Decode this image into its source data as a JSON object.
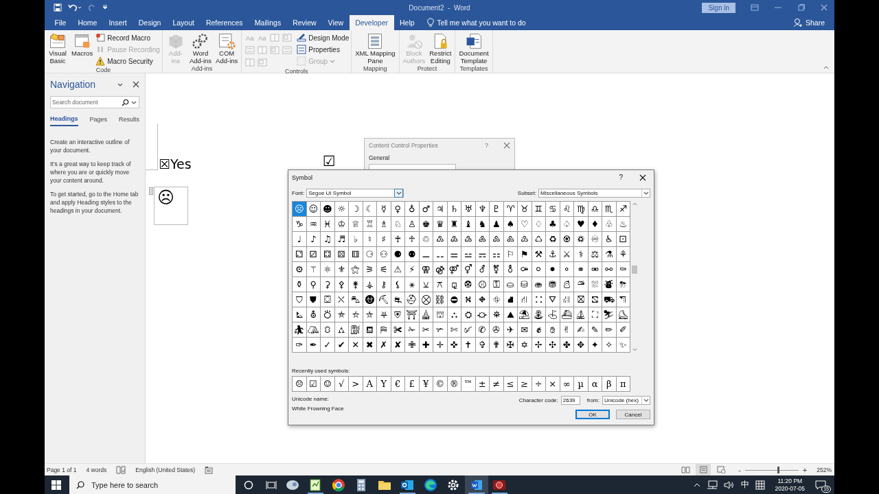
{
  "title_bar": {
    "title": "Document2  -  Word",
    "sign_in": "Sign in"
  },
  "tabs": [
    {
      "label": "File",
      "selected": false
    },
    {
      "label": "Home",
      "selected": false
    },
    {
      "label": "Insert",
      "selected": false
    },
    {
      "label": "Design",
      "selected": false
    },
    {
      "label": "Layout",
      "selected": false
    },
    {
      "label": "References",
      "selected": false
    },
    {
      "label": "Mailings",
      "selected": false
    },
    {
      "label": "Review",
      "selected": false
    },
    {
      "label": "View",
      "selected": false
    },
    {
      "label": "Developer",
      "selected": true
    },
    {
      "label": "Help",
      "selected": false
    }
  ],
  "tell_me": "Tell me what you want to do",
  "share": "Share",
  "ribbon": {
    "groups": [
      {
        "label": "Code",
        "items": [
          {
            "kind": "large",
            "label": "Visual\nBasic",
            "disabled": false
          },
          {
            "kind": "large",
            "label": "Macros",
            "disabled": false
          },
          {
            "kind": "small",
            "label": "Record Macro",
            "disabled": false
          },
          {
            "kind": "small",
            "label": "Pause Recording",
            "disabled": true
          },
          {
            "kind": "small",
            "label": "Macro Security",
            "disabled": false
          }
        ]
      },
      {
        "label": "Add-ins",
        "items": [
          {
            "kind": "large",
            "label": "Add-\nins",
            "disabled": true
          },
          {
            "kind": "large",
            "label": "Word\nAdd-ins",
            "disabled": false
          },
          {
            "kind": "large",
            "label": "COM\nAdd-ins",
            "disabled": false
          }
        ]
      },
      {
        "label": "Controls",
        "items": [
          {
            "kind": "tool",
            "text": "Aa",
            "disabled": true
          },
          {
            "kind": "tool",
            "text": "Aa",
            "disabled": true
          },
          {
            "kind": "tool",
            "disabled": true
          },
          {
            "kind": "tool",
            "disabled": true
          },
          {
            "kind": "tool",
            "disabled": true
          },
          {
            "kind": "tool",
            "disabled": true
          },
          {
            "kind": "tool",
            "disabled": true
          },
          {
            "kind": "tool",
            "disabled": true
          },
          {
            "kind": "tool",
            "disabled": true
          },
          {
            "kind": "tool",
            "disabled": true
          },
          {
            "kind": "small",
            "label": "Design Mode",
            "disabled": false
          },
          {
            "kind": "small",
            "label": "Properties",
            "disabled": false
          },
          {
            "kind": "small",
            "label": "Group",
            "disabled": true
          }
        ]
      },
      {
        "label": "Mapping",
        "items": [
          {
            "kind": "large",
            "label": "XML Mapping\nPane",
            "disabled": false
          }
        ]
      },
      {
        "label": "Protect",
        "items": [
          {
            "kind": "large",
            "label": "Block\nAuthors",
            "disabled": true
          },
          {
            "kind": "large",
            "label": "Restrict\nEditing",
            "disabled": false
          }
        ]
      },
      {
        "label": "Templates",
        "items": [
          {
            "kind": "large",
            "label": "Document\nTemplate",
            "disabled": false
          }
        ]
      }
    ]
  },
  "navigation": {
    "title": "Navigation",
    "search_placeholder": "Search document",
    "tabs": [
      {
        "label": "Headings",
        "selected": true
      },
      {
        "label": "Pages",
        "selected": false
      },
      {
        "label": "Results",
        "selected": false
      }
    ],
    "paragraphs": [
      "Create an interactive outline of your document.",
      "It’s a great way to keep track of where you are or quickly move your content around.",
      "To get started, go to the Home tab and apply Heading styles to the headings in your document."
    ]
  },
  "document": {
    "yes_line": "☒Yes",
    "check": "☑",
    "control_symbol": "☹"
  },
  "content_control_dialog": {
    "title": "Content Control Properties",
    "help": "?",
    "section": "General"
  },
  "symbol_dialog": {
    "title": "Symbol",
    "help": "?",
    "font_label": "Font:",
    "font": "Segoe UI Symbol",
    "subset_label": "Subset:",
    "subset": "Miscellaneous Symbols",
    "grid": [
      [
        {
          "char": "☹",
          "selected": true
        },
        {
          "char": "☺",
          "selected": false
        },
        {
          "char": "☻",
          "selected": false
        },
        {
          "char": "☼",
          "selected": false
        },
        {
          "char": "☽",
          "selected": false
        },
        {
          "char": "☾",
          "selected": false
        },
        {
          "char": "☿",
          "selected": false
        },
        {
          "char": "♀",
          "selected": false
        },
        {
          "char": "♁",
          "selected": false
        },
        {
          "char": "♂",
          "selected": false
        },
        {
          "char": "♃",
          "selected": false
        },
        {
          "char": "♄",
          "selected": false
        },
        {
          "char": "♅",
          "selected": false
        },
        {
          "char": "♆",
          "selected": false
        },
        {
          "char": "♇",
          "selected": false
        },
        {
          "char": "♈",
          "selected": false
        },
        {
          "char": "♉",
          "selected": false
        },
        {
          "char": "♊",
          "selected": false
        },
        {
          "char": "♋",
          "selected": false
        },
        {
          "char": "♌",
          "selected": false
        },
        {
          "char": "♍",
          "selected": false
        },
        {
          "char": "♎",
          "selected": false
        },
        {
          "char": "♏",
          "selected": false
        },
        {
          "char": "♐",
          "selected": false
        }
      ],
      [
        {
          "char": "♑",
          "selected": false
        },
        {
          "char": "♒",
          "selected": false
        },
        {
          "char": "♓",
          "selected": false
        },
        {
          "char": "♔",
          "selected": false
        },
        {
          "char": "♕",
          "selected": false
        },
        {
          "char": "♖",
          "selected": false
        },
        {
          "char": "♗",
          "selected": false
        },
        {
          "char": "♘",
          "selected": false
        },
        {
          "char": "♙",
          "selected": false
        },
        {
          "char": "♚",
          "selected": false
        },
        {
          "char": "♛",
          "selected": false
        },
        {
          "char": "♜",
          "selected": false
        },
        {
          "char": "♝",
          "selected": false
        },
        {
          "char": "♞",
          "selected": false
        },
        {
          "char": "♟",
          "selected": false
        },
        {
          "char": "♠",
          "selected": false
        },
        {
          "char": "♡",
          "selected": false
        },
        {
          "char": "♢",
          "selected": false
        },
        {
          "char": "♣",
          "selected": false
        },
        {
          "char": "♤",
          "selected": false
        },
        {
          "char": "♥",
          "selected": false
        },
        {
          "char": "♦",
          "selected": false
        },
        {
          "char": "♧",
          "selected": false
        },
        {
          "char": "♨",
          "selected": false
        }
      ],
      [
        {
          "char": "♩",
          "selected": false
        },
        {
          "char": "♪",
          "selected": false
        },
        {
          "char": "♫",
          "selected": false
        },
        {
          "char": "♬",
          "selected": false
        },
        {
          "char": "♭",
          "selected": false
        },
        {
          "char": "♮",
          "selected": false
        },
        {
          "char": "♯",
          "selected": false
        },
        {
          "char": "♰",
          "selected": false
        },
        {
          "char": "♱",
          "selected": false
        },
        {
          "char": "♲",
          "selected": false
        },
        {
          "char": "♳",
          "selected": false
        },
        {
          "char": "♴",
          "selected": false
        },
        {
          "char": "♵",
          "selected": false
        },
        {
          "char": "♶",
          "selected": false
        },
        {
          "char": "♷",
          "selected": false
        },
        {
          "char": "♸",
          "selected": false
        },
        {
          "char": "♹",
          "selected": false
        },
        {
          "char": "♺",
          "selected": false
        },
        {
          "char": "♻",
          "selected": false
        },
        {
          "char": "♼",
          "selected": false
        },
        {
          "char": "♽",
          "selected": false
        },
        {
          "char": "♾",
          "selected": false
        },
        {
          "char": "♿",
          "selected": false
        },
        {
          "char": "⚀",
          "selected": false
        }
      ],
      [
        {
          "char": "⚁",
          "selected": false
        },
        {
          "char": "⚂",
          "selected": false
        },
        {
          "char": "⚃",
          "selected": false
        },
        {
          "char": "⚄",
          "selected": false
        },
        {
          "char": "⚅",
          "selected": false
        },
        {
          "char": "⚆",
          "selected": false
        },
        {
          "char": "⚇",
          "selected": false
        },
        {
          "char": "⚈",
          "selected": false
        },
        {
          "char": "⚉",
          "selected": false
        },
        {
          "char": "⚊",
          "selected": false
        },
        {
          "char": "⚋",
          "selected": false
        },
        {
          "char": "⚌",
          "selected": false
        },
        {
          "char": "⚍",
          "selected": false
        },
        {
          "char": "⚎",
          "selected": false
        },
        {
          "char": "⚏",
          "selected": false
        },
        {
          "char": "⚐",
          "selected": false
        },
        {
          "char": "⚑",
          "selected": false
        },
        {
          "char": "⚒",
          "selected": false
        },
        {
          "char": "⚓",
          "selected": false
        },
        {
          "char": "⚔",
          "selected": false
        },
        {
          "char": "⚕",
          "selected": false
        },
        {
          "char": "⚖",
          "selected": false
        },
        {
          "char": "⚗",
          "selected": false
        },
        {
          "char": "⚘",
          "selected": false
        }
      ],
      [
        {
          "char": "⚙",
          "selected": false
        },
        {
          "char": "⚚",
          "selected": false
        },
        {
          "char": "⚛",
          "selected": false
        },
        {
          "char": "⚜",
          "selected": false
        },
        {
          "char": "⚝",
          "selected": false
        },
        {
          "char": "⚞",
          "selected": false
        },
        {
          "char": "⚟",
          "selected": false
        },
        {
          "char": "⚠",
          "selected": false
        },
        {
          "char": "⚡",
          "selected": false
        },
        {
          "char": "⚢",
          "selected": false
        },
        {
          "char": "⚣",
          "selected": false
        },
        {
          "char": "⚤",
          "selected": false
        },
        {
          "char": "⚥",
          "selected": false
        },
        {
          "char": "⚦",
          "selected": false
        },
        {
          "char": "⚧",
          "selected": false
        },
        {
          "char": "⚨",
          "selected": false
        },
        {
          "char": "⚩",
          "selected": false
        },
        {
          "char": "⚪",
          "selected": false
        },
        {
          "char": "⚫",
          "selected": false
        },
        {
          "char": "⚬",
          "selected": false
        },
        {
          "char": "⚭",
          "selected": false
        },
        {
          "char": "⚮",
          "selected": false
        },
        {
          "char": "⚯",
          "selected": false
        },
        {
          "char": "⚰",
          "selected": false
        }
      ],
      [
        {
          "char": "⚱",
          "selected": false
        },
        {
          "char": "⚲",
          "selected": false
        },
        {
          "char": "⚳",
          "selected": false
        },
        {
          "char": "⚴",
          "selected": false
        },
        {
          "char": "⚵",
          "selected": false
        },
        {
          "char": "⚶",
          "selected": false
        },
        {
          "char": "⚷",
          "selected": false
        },
        {
          "char": "⚸",
          "selected": false
        },
        {
          "char": "⚹",
          "selected": false
        },
        {
          "char": "⚺",
          "selected": false
        },
        {
          "char": "⚻",
          "selected": false
        },
        {
          "char": "⚼",
          "selected": false
        },
        {
          "char": "⚽",
          "selected": false
        },
        {
          "char": "⚾",
          "selected": false
        },
        {
          "char": "⚿",
          "selected": false
        },
        {
          "char": "⛀",
          "selected": false
        },
        {
          "char": "⛁",
          "selected": false
        },
        {
          "char": "⛂",
          "selected": false
        },
        {
          "char": "⛃",
          "selected": false
        },
        {
          "char": "⛄",
          "selected": false
        },
        {
          "char": "⛅",
          "selected": false
        },
        {
          "char": "⛆",
          "selected": false
        },
        {
          "char": "⛇",
          "selected": false
        },
        {
          "char": "⛈",
          "selected": false
        }
      ],
      [
        {
          "char": "⛉",
          "selected": false
        },
        {
          "char": "⛊",
          "selected": false
        },
        {
          "char": "⛋",
          "selected": false
        },
        {
          "char": "⛌",
          "selected": false
        },
        {
          "char": "⛍",
          "selected": false
        },
        {
          "char": "⛎",
          "selected": false
        },
        {
          "char": "⛏",
          "selected": false
        },
        {
          "char": "⛐",
          "selected": false
        },
        {
          "char": "⛑",
          "selected": false
        },
        {
          "char": "⛒",
          "selected": false
        },
        {
          "char": "⛓",
          "selected": false
        },
        {
          "char": "⛔",
          "selected": false
        },
        {
          "char": "⛕",
          "selected": false
        },
        {
          "char": "⛖",
          "selected": false
        },
        {
          "char": "⛗",
          "selected": false
        },
        {
          "char": "⛘",
          "selected": false
        },
        {
          "char": "⛙",
          "selected": false
        },
        {
          "char": "⛚",
          "selected": false
        },
        {
          "char": "⛛",
          "selected": false
        },
        {
          "char": "⛜",
          "selected": false
        },
        {
          "char": "⛝",
          "selected": false
        },
        {
          "char": "⛞",
          "selected": false
        },
        {
          "char": "⛟",
          "selected": false
        },
        {
          "char": "⛠",
          "selected": false
        }
      ],
      [
        {
          "char": "⛡",
          "selected": false
        },
        {
          "char": "⛢",
          "selected": false
        },
        {
          "char": "⛣",
          "selected": false
        },
        {
          "char": "⛤",
          "selected": false
        },
        {
          "char": "⛥",
          "selected": false
        },
        {
          "char": "⛦",
          "selected": false
        },
        {
          "char": "⛧",
          "selected": false
        },
        {
          "char": "⛨",
          "selected": false
        },
        {
          "char": "⛩",
          "selected": false
        },
        {
          "char": "⛪",
          "selected": false
        },
        {
          "char": "⛫",
          "selected": false
        },
        {
          "char": "⛬",
          "selected": false
        },
        {
          "char": "⛭",
          "selected": false
        },
        {
          "char": "⛮",
          "selected": false
        },
        {
          "char": "⛯",
          "selected": false
        },
        {
          "char": "⛰",
          "selected": false
        },
        {
          "char": "⛱",
          "selected": false
        },
        {
          "char": "⛲",
          "selected": false
        },
        {
          "char": "⛳",
          "selected": false
        },
        {
          "char": "⛴",
          "selected": false
        },
        {
          "char": "⛵",
          "selected": false
        },
        {
          "char": "⛶",
          "selected": false
        },
        {
          "char": "⛷",
          "selected": false
        },
        {
          "char": "⛸",
          "selected": false
        }
      ],
      [
        {
          "char": "⛹",
          "selected": false
        },
        {
          "char": "⛺",
          "selected": false
        },
        {
          "char": "⛻",
          "selected": false
        },
        {
          "char": "⛼",
          "selected": false
        },
        {
          "char": "⛽",
          "selected": false
        },
        {
          "char": "⛾",
          "selected": false
        },
        {
          "char": "⛿",
          "selected": false
        },
        {
          "char": "✀",
          "selected": false
        },
        {
          "char": "✁",
          "selected": false
        },
        {
          "char": "✂",
          "selected": false
        },
        {
          "char": "✃",
          "selected": false
        },
        {
          "char": "✄",
          "selected": false
        },
        {
          "char": "✅",
          "selected": false
        },
        {
          "char": "✆",
          "selected": false
        },
        {
          "char": "✇",
          "selected": false
        },
        {
          "char": "✈",
          "selected": false
        },
        {
          "char": "✉",
          "selected": false
        },
        {
          "char": "✊",
          "selected": false
        },
        {
          "char": "✋",
          "selected": false
        },
        {
          "char": "✌",
          "selected": false
        },
        {
          "char": "✍",
          "selected": false
        },
        {
          "char": "✎",
          "selected": false
        },
        {
          "char": "✏",
          "selected": false
        },
        {
          "char": "✐",
          "selected": false
        }
      ],
      [
        {
          "char": "✑",
          "selected": false
        },
        {
          "char": "✒",
          "selected": false
        },
        {
          "char": "✓",
          "selected": false
        },
        {
          "char": "✔",
          "selected": false
        },
        {
          "char": "✕",
          "selected": false
        },
        {
          "char": "✖",
          "selected": false
        },
        {
          "char": "✗",
          "selected": false
        },
        {
          "char": "✘",
          "selected": false
        },
        {
          "char": "✙",
          "selected": false
        },
        {
          "char": "✚",
          "selected": false
        },
        {
          "char": "✛",
          "selected": false
        },
        {
          "char": "✜",
          "selected": false
        },
        {
          "char": "✝",
          "selected": false
        },
        {
          "char": "✞",
          "selected": false
        },
        {
          "char": "✟",
          "selected": false
        },
        {
          "char": "✠",
          "selected": false
        },
        {
          "char": "✡",
          "selected": false
        },
        {
          "char": "✢",
          "selected": false
        },
        {
          "char": "✣",
          "selected": false
        },
        {
          "char": "✤",
          "selected": false
        },
        {
          "char": "✥",
          "selected": false
        },
        {
          "char": "✦",
          "selected": false
        },
        {
          "char": "✧",
          "selected": false
        },
        {
          "char": "✨",
          "selected": false
        }
      ]
    ],
    "recent_label": "Recently used symbols:",
    "recent": [
      "☹",
      "☑",
      "☺",
      "√",
      ">",
      "A",
      "Y",
      "€",
      "£",
      "¥",
      "©",
      "®",
      "™",
      "±",
      "≠",
      "≤",
      "≥",
      "÷",
      "×",
      "∞",
      "µ",
      "α",
      "β",
      "π"
    ],
    "unicode_name_label": "Unicode name:",
    "unicode_name": "White Frowning Face",
    "char_code_label": "Character code:",
    "char_code": "2639",
    "from_label": "from:",
    "from": "Unicode (hex)",
    "ok": "OK",
    "cancel": "Cancel"
  },
  "status_bar": {
    "page": "Page 1 of 1",
    "words": "4 words",
    "language": "English (United States)",
    "views": [
      {
        "selected": false
      },
      {
        "selected": true
      },
      {
        "selected": false
      }
    ],
    "zoom_minus": "-",
    "zoom_plus": "+",
    "level": 0.62,
    "zoom": "252%"
  },
  "taskbar": {
    "search_placeholder": "Type here to search",
    "apps": [
      {
        "running": false,
        "selected": false
      },
      {
        "running": true,
        "selected": false
      },
      {
        "running": false,
        "selected": false
      },
      {
        "running": false,
        "selected": false
      },
      {
        "running": false,
        "selected": false
      },
      {
        "running": true,
        "selected": false
      },
      {
        "running": false,
        "selected": false
      },
      {
        "running": false,
        "selected": false
      },
      {
        "running": true,
        "selected": true
      },
      {
        "running": true,
        "selected": false
      }
    ],
    "ime": "中",
    "time": "11:20 PM",
    "date": "2020-07-05",
    "notifications": "15"
  }
}
